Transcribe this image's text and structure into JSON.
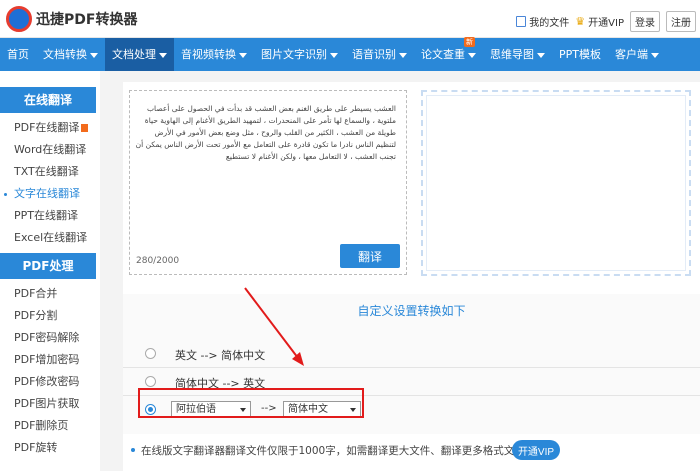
{
  "header": {
    "logo_text": "迅捷PDF转换器",
    "my_files": "我的文件",
    "open_vip": "开通VIP",
    "login": "登录",
    "register": "注册"
  },
  "nav": {
    "items": [
      "首页",
      "文档转换",
      "文档处理",
      "音视频转换",
      "图片文字识别",
      "语音识别",
      "论文查重",
      "思维导图",
      "PPT模板",
      "客户端"
    ],
    "new_badge": "新"
  },
  "sidebar": {
    "section1": "在线翻译",
    "items1": [
      "PDF在线翻译",
      "Word在线翻译",
      "TXT在线翻译",
      "文字在线翻译",
      "PPT在线翻译",
      "Excel在线翻译"
    ],
    "section2": "PDF处理",
    "items2": [
      "PDF合并",
      "PDF分割",
      "PDF密码解除",
      "PDF增加密码",
      "PDF修改密码",
      "PDF图片获取",
      "PDF删除页",
      "PDF旋转"
    ]
  },
  "source": {
    "text": "العشب يسيطر على طريق الغنم بعض العشب قد بدأت في الحصول على أعصاب ملتوية ، والسماع لها تأمر على المنحدرات ، لتمهيد الطريق الأغنام إلى الهاوية حياة طويلة من العشب ، الكثير من القلب والروح ، مثل وضع بعض الأمور في الأرض لتنظيم الناس نادرا ما تكون قادرة على التعامل مع الأمور تحت الأرض الناس يمكن أن تجنب العشب ، لا التعامل معها ، ولكن الأغنام لا تستطيع",
    "count": "280/2000",
    "translate_btn": "翻译"
  },
  "options": {
    "title": "自定义设置转换如下",
    "row1": "英文 --> 简体中文",
    "row2": "简体中文 --> 英文",
    "from_lang": "阿拉伯语",
    "arrow": "-->",
    "to_lang": "简体中文"
  },
  "note": {
    "text": "在线版文字翻译器翻译文件仅限于1000字，如需翻译更大文件、翻译更多格式文件，请",
    "vip_btn": "开通VIP"
  },
  "colors": {
    "primary": "#2a88d8",
    "nav_active": "#1a5ea3",
    "annotation_red": "#e21b1b",
    "badge_orange": "#f36b1c"
  }
}
